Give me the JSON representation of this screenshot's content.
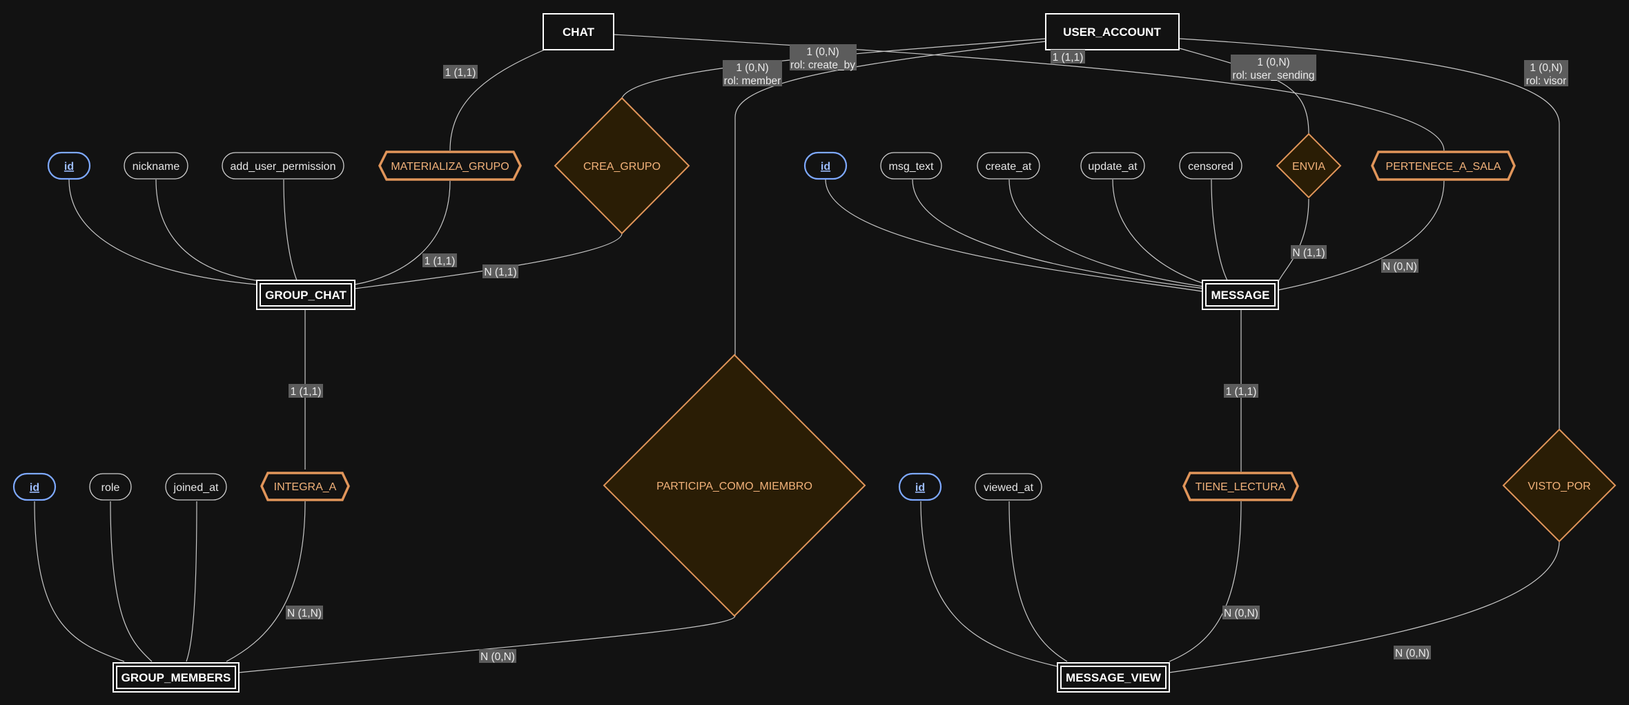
{
  "diagram": {
    "entities": [
      {
        "id": "chat",
        "label": "CHAT",
        "weak": false
      },
      {
        "id": "user_account",
        "label": "USER_ACCOUNT",
        "weak": false
      },
      {
        "id": "group_chat",
        "label": "GROUP_CHAT",
        "weak": true
      },
      {
        "id": "message",
        "label": "MESSAGE",
        "weak": true
      },
      {
        "id": "group_members",
        "label": "GROUP_MEMBERS",
        "weak": true
      },
      {
        "id": "message_view",
        "label": "MESSAGE_VIEW",
        "weak": true
      }
    ],
    "attributes": [
      {
        "id": "gc_id",
        "label": "id",
        "key": true,
        "owner": "group_chat"
      },
      {
        "id": "gc_nickname",
        "label": "nickname",
        "key": false,
        "owner": "group_chat"
      },
      {
        "id": "gc_perm",
        "label": "add_user_permission",
        "key": false,
        "owner": "group_chat"
      },
      {
        "id": "m_id",
        "label": "id",
        "key": true,
        "owner": "message"
      },
      {
        "id": "m_text",
        "label": "msg_text",
        "key": false,
        "owner": "message"
      },
      {
        "id": "m_create",
        "label": "create_at",
        "key": false,
        "owner": "message"
      },
      {
        "id": "m_update",
        "label": "update_at",
        "key": false,
        "owner": "message"
      },
      {
        "id": "m_censored",
        "label": "censored",
        "key": false,
        "owner": "message"
      },
      {
        "id": "gm_id",
        "label": "id",
        "key": true,
        "owner": "group_members"
      },
      {
        "id": "gm_role",
        "label": "role",
        "key": false,
        "owner": "group_members"
      },
      {
        "id": "gm_joined",
        "label": "joined_at",
        "key": false,
        "owner": "group_members"
      },
      {
        "id": "mv_id",
        "label": "id",
        "key": true,
        "owner": "message_view"
      },
      {
        "id": "mv_viewed",
        "label": "viewed_at",
        "key": false,
        "owner": "message_view"
      }
    ],
    "relationships": [
      {
        "id": "materializa_grupo",
        "label": "MATERIALIZA_GRUPO",
        "identifying": true
      },
      {
        "id": "crea_grupo",
        "label": "CREA_GRUPO",
        "identifying": false
      },
      {
        "id": "envia",
        "label": "ENVIA",
        "identifying": false
      },
      {
        "id": "pertenece_a_sala",
        "label": "PERTENECE_A_SALA",
        "identifying": true
      },
      {
        "id": "integra_a",
        "label": "INTEGRA_A",
        "identifying": true
      },
      {
        "id": "participa_como_miembro",
        "label": "PARTICIPA_COMO_MIEMBRO",
        "identifying": false
      },
      {
        "id": "tiene_lectura",
        "label": "TIENE_LECTURA",
        "identifying": true
      },
      {
        "id": "visto_por",
        "label": "VISTO_POR",
        "identifying": false
      }
    ],
    "edge_labels": [
      {
        "id": "l_chat_mat",
        "lines": [
          "1 (1,1)"
        ]
      },
      {
        "id": "l_mat_gc",
        "lines": [
          "1 (1,1)"
        ]
      },
      {
        "id": "l_crea_user",
        "lines": [
          "1 (0,N)",
          "rol: create_by"
        ]
      },
      {
        "id": "l_crea_gc",
        "lines": [
          "N (1,1)"
        ]
      },
      {
        "id": "l_part_user",
        "lines": [
          "1 (0,N)",
          "rol: member"
        ]
      },
      {
        "id": "l_chat_pert",
        "lines": [
          "1 (1,1)"
        ]
      },
      {
        "id": "l_envia_user",
        "lines": [
          "1 (0,N)",
          "rol: user_sending"
        ]
      },
      {
        "id": "l_visto_user",
        "lines": [
          "1 (0,N)",
          "rol: visor"
        ]
      },
      {
        "id": "l_envia_msg",
        "lines": [
          "N (1,1)"
        ]
      },
      {
        "id": "l_pert_msg",
        "lines": [
          "N (0,N)"
        ]
      },
      {
        "id": "l_gc_integra",
        "lines": [
          "1 (1,1)"
        ]
      },
      {
        "id": "l_msg_tiene",
        "lines": [
          "1 (1,1)"
        ]
      },
      {
        "id": "l_integra_gm",
        "lines": [
          "N (1,N)"
        ]
      },
      {
        "id": "l_part_gm",
        "lines": [
          "N (0,N)"
        ]
      },
      {
        "id": "l_tiene_mv",
        "lines": [
          "N (0,N)"
        ]
      },
      {
        "id": "l_visto_mv",
        "lines": [
          "N (0,N)"
        ]
      }
    ]
  },
  "colors": {
    "background": "#121212",
    "entity_stroke": "#ffffff",
    "key_attribute": "#7ea9ff",
    "relationship_stroke": "#e0955a",
    "relationship_fill": "#2a1d05",
    "edge": "#c8c8c8",
    "label_background": "#5c5c5c"
  }
}
